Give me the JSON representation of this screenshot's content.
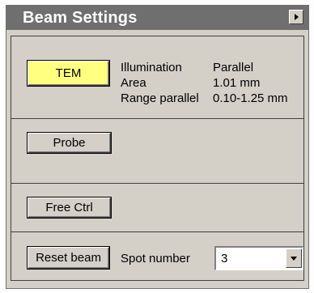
{
  "panel": {
    "title": "Beam Settings",
    "collapse_icon": "triangle-right-icon"
  },
  "mode_section": {
    "tem_label": "TEM",
    "tem_active_color": "#ffff80",
    "info": [
      {
        "label": "Illumination",
        "value": "Parallel"
      },
      {
        "label": "Area",
        "value": "1.01 mm"
      },
      {
        "label": "Range parallel",
        "value": "0.10-1.25 mm"
      }
    ]
  },
  "probe_section": {
    "probe_label": "Probe"
  },
  "free_section": {
    "free_label": "Free Ctrl"
  },
  "spot_section": {
    "reset_label": "Reset beam",
    "spot_label": "Spot number",
    "spot_value": "3",
    "dropdown_icon": "chevron-down-icon"
  }
}
